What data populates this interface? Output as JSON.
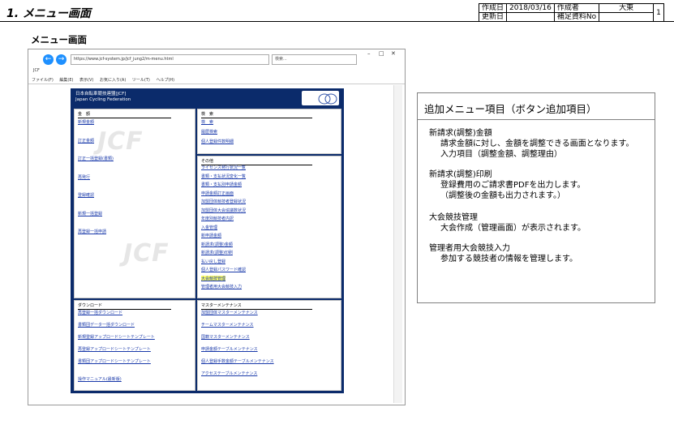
{
  "header": {
    "doc_title": "1. メニュー画面",
    "created_label": "作成日",
    "created_date": "2018/03/16",
    "author_label": "作成者",
    "author": "大東",
    "page": "1",
    "updated_label": "更新日",
    "supplement_label": "補足資料No"
  },
  "section_label": "メニュー画面",
  "browser": {
    "url": "https://www.jcf-system.jp/jcf_jung2/m-menu.html",
    "search_placeholder": "検索...",
    "tab": "JCF",
    "menu": [
      "ファイル(F)",
      "編集(E)",
      "表示(V)",
      "お気に入り(A)",
      "ツール(T)",
      "ヘルプ(H)"
    ],
    "site_name": "日本自転車競技連盟[JCF]\nJapan Cycling Federation",
    "watermark": "JCF",
    "panels": {
      "kingaku": {
        "title": "金　額",
        "links": [
          "新規金額",
          "訂正金額",
          "訂正一括登録(書類)",
          "再発行",
          "登録確認",
          "新規一括登録",
          "再登録一括申請"
        ]
      },
      "kensaku": {
        "title": "検　索",
        "links": [
          "検　索",
          "履歴検索",
          "個人登録件数明細"
        ]
      },
      "sonota": {
        "title": "その他",
        "links": [
          "ライセンス発行状況一覧",
          "書類・支払状況変化一覧",
          "書類・支払別申請金額",
          "申請金額訂正画面",
          "加盟団体競技者登録状況",
          "加盟団体大会協議数状況",
          "年度別競技者内訳",
          "入金管理",
          "新申請金額",
          "新請求(調整)金額",
          "新請求(調整)印刷",
          "払い戻し登録",
          "個人登録パスワード確認",
          "大会競技管理",
          "管理者用大会競技入力"
        ]
      },
      "download": {
        "title": "ダウンロード",
        "links": [
          "再登録一括ダウンロード",
          "書類団データ一括ダウンロード",
          "新規登録アップロードシートテンプレート",
          "再登録アップロードシートテンプレート",
          "書類団アップロードシートテンプレート",
          "操作マニュアル(最新版)"
        ]
      },
      "master": {
        "title": "マスターメンテナンス",
        "links": [
          "加盟団体マスターメンテナンス",
          "チームマスターメンテナンス",
          "国籍マスターメンテナンス",
          "申請金額テーブルメンテナンス",
          "個人登録手数金額テーブルメンテナンス",
          "アクセステーブルメンテナンス"
        ]
      }
    }
  },
  "info": {
    "title": "追加メニュー項目（ボタン追加項目）",
    "lines": [
      "新請求(調整)金額",
      "請求金額に対し、金額を調整できる画面となります。",
      "入力項目（調整金額、調整理由）",
      "新請求(調整)印刷",
      "登録費用のご請求書PDFを出力します。",
      "（調整後の金額も出力されます。）",
      "大会競技管理",
      "大会作成（管理画面）が表示されます。",
      "管理者用大会競技入力",
      "参加する競技者の情報を管理します。"
    ]
  }
}
